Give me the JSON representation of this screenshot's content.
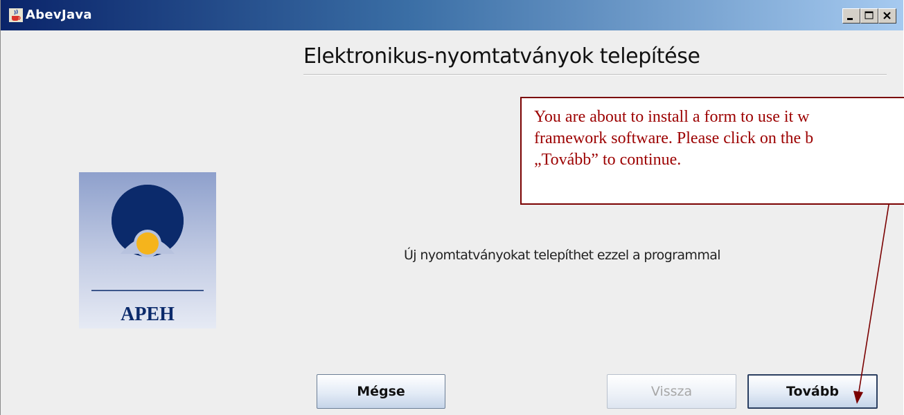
{
  "window": {
    "title": "AbevJava",
    "icons": {
      "app": "java-cup-icon",
      "minimize": "minimize-icon",
      "maximize": "maximize-icon",
      "close": "close-icon"
    }
  },
  "main": {
    "heading": "Elektronikus-nyomtatványok telepítése",
    "subtitle": "Új nyomtatványokat telepíthet ezzel a programmal",
    "logo_text": "APEH"
  },
  "buttons": {
    "cancel": "Mégse",
    "back": "Vissza",
    "next": "Tovább"
  },
  "callout": {
    "line1": "You are about to install a form to use it w",
    "line2": "framework software. Please click on the b",
    "line3": "„Tovább” to continue.",
    "color": "#9c0000"
  },
  "colors": {
    "titlebar_start": "#0a246a",
    "titlebar_end": "#a6caf0",
    "logo_dark": "#0b2a6b",
    "logo_sun": "#f5b41c"
  }
}
